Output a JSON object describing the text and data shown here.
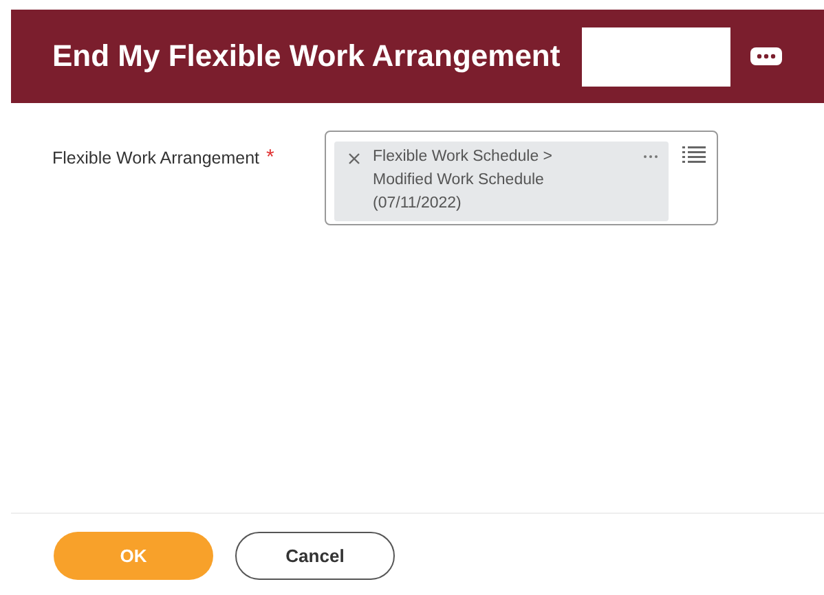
{
  "header": {
    "title": "End My Flexible Work Arrangement"
  },
  "field": {
    "label": "Flexible Work Arrangement",
    "required_mark": "*",
    "selections": [
      {
        "lines": [
          "Flexible Work Schedule >",
          "Modified Work Schedule",
          "(07/11/2022)"
        ]
      }
    ]
  },
  "buttons": [
    {
      "label": "OK",
      "kind": "primary"
    },
    {
      "label": "Cancel",
      "kind": "secondary"
    }
  ]
}
